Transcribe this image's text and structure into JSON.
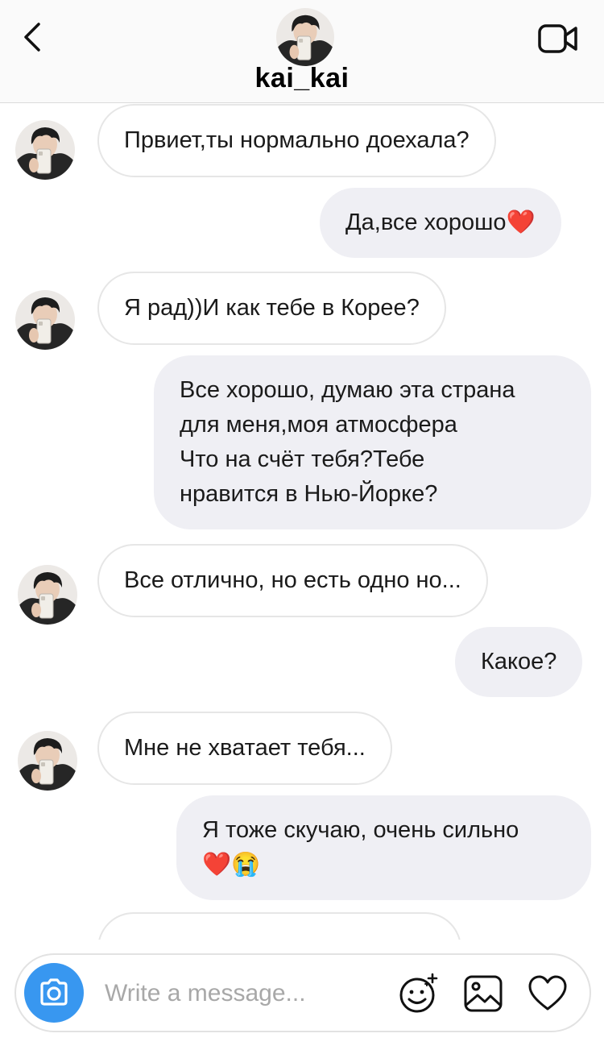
{
  "header": {
    "username": "kai_kai",
    "back_icon": "chevron-left-icon",
    "video_icon": "video-camera-icon"
  },
  "messages": [
    {
      "side": "in",
      "text": "Првиет,ты нормально доехала?"
    },
    {
      "side": "out",
      "text": "Да,все хорошо❤️"
    },
    {
      "side": "in",
      "text": "Я рад))И как тебе в Корее?"
    },
    {
      "side": "out",
      "text": "Все хорошо, думаю эта страна\nдля меня,моя атмосфера\nЧто на счёт тебя?Тебе\nнравится в Нью-Йорке?"
    },
    {
      "side": "in",
      "text": "Все отлично, но есть одно но..."
    },
    {
      "side": "out",
      "text": "Какое?"
    },
    {
      "side": "in",
      "text": "Мне не хватает тебя..."
    },
    {
      "side": "out",
      "text": "Я тоже скучаю, очень сильно\n❤️😭"
    }
  ],
  "composer": {
    "placeholder": "Write a message...",
    "camera_icon": "camera-icon",
    "sticker_icon": "sticker-smiley-icon",
    "gallery_icon": "gallery-image-icon",
    "like_icon": "heart-icon"
  },
  "colors": {
    "accent": "#3897f0",
    "outgoing_bubble": "#efeff4",
    "incoming_border": "#e6e6e6",
    "header_bg": "#fafafa"
  }
}
